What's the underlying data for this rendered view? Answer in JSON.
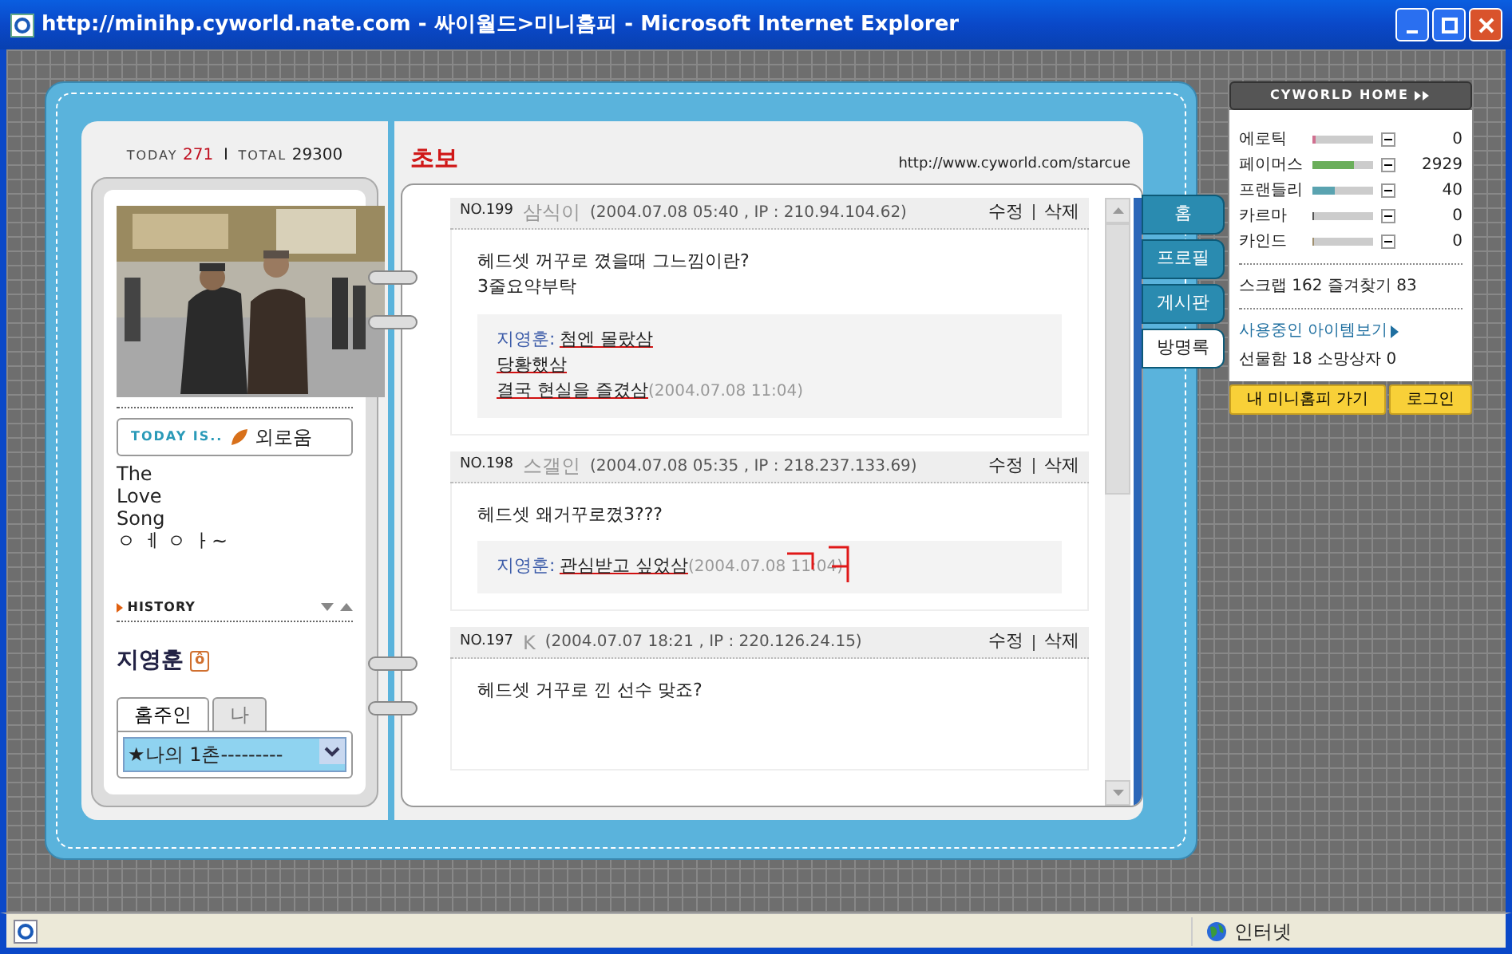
{
  "window": {
    "title": "http://minihp.cyworld.nate.com - 싸이월드>미니홈피 - Microsoft Internet Explorer"
  },
  "counter": {
    "today_label": "TODAY",
    "today": "271",
    "separator": "I",
    "total_label": "TOTAL",
    "total": "29300"
  },
  "profile": {
    "picture": {
      "kind": "picture"
    },
    "today_is": "TODAY IS..",
    "mood": "외로움",
    "intro": [
      "The",
      "Love",
      "Song",
      "ㅇ ㅔ ㅇ ㅏ~"
    ],
    "history": "HISTORY",
    "owner": "지영훈",
    "owner_badge": "ô",
    "tabs": [
      {
        "label": "홈주인",
        "selected": true
      },
      {
        "label": "나",
        "selected": false
      }
    ],
    "select": "★나의 1촌---------"
  },
  "page": {
    "title": "초보",
    "url": "http://www.cyworld.com/starcue"
  },
  "guestbook": [
    {
      "no_label": "NO.",
      "no": "199",
      "author": "삼식이",
      "meta": "(2004.07.08 05:40 , IP : 210.94.104.62)",
      "edit": "수정",
      "delete": "삭제",
      "body": [
        "헤드셋 꺼꾸로 꼈을때 그느낌이란?",
        "3줄요약부탁"
      ],
      "reply": {
        "author": "지영훈:",
        "lines": [
          "첨엔 몰랐삼",
          "당황했삼",
          "결국 현실을 즐겼삼"
        ],
        "time": "(2004.07.08 11:04)"
      },
      "scribble": false
    },
    {
      "no_label": "NO.",
      "no": "198",
      "author": "스갤인",
      "meta": "(2004.07.08 05:35 , IP : 218.237.133.69)",
      "edit": "수정",
      "delete": "삭제",
      "body": [
        "헤드셋 왜거꾸로꼈3???"
      ],
      "reply": {
        "author": "지영훈:",
        "lines": [
          "관심받고 싶었삼"
        ],
        "time": "(2004.07.08 11:04)"
      },
      "scribble": true
    },
    {
      "no_label": "NO.",
      "no": "197",
      "author": "K",
      "meta": "(2004.07.07 18:21 , IP : 220.126.24.15)",
      "edit": "수정",
      "delete": "삭제",
      "body": [
        "헤드셋 거꾸로 낀 선수 맞죠?"
      ]
    }
  ],
  "tabs": [
    {
      "label": "홈",
      "selected": false
    },
    {
      "label": "프로필",
      "selected": false
    },
    {
      "label": "게시판",
      "selected": false
    },
    {
      "label": "방명록",
      "selected": true
    }
  ],
  "side": {
    "home": "CYWORLD HOME",
    "stats": [
      {
        "name": "에로틱",
        "level": 0.04,
        "color": "#d07090",
        "value": "0"
      },
      {
        "name": "페이머스",
        "level": 0.68,
        "color": "#6aae5a",
        "value": "2929"
      },
      {
        "name": "프랜들리",
        "level": 0.38,
        "color": "#5aa3b0",
        "value": "40"
      },
      {
        "name": "카르마",
        "level": 0.02,
        "color": "#555555",
        "value": "0"
      },
      {
        "name": "카인드",
        "level": 0.02,
        "color": "#a09070",
        "value": "0"
      }
    ],
    "scrap": "스크랩 162 즐겨찾기 83",
    "items_link": "사용중인 아이템보기",
    "gift": "선물함 18 소망상자 0",
    "buttons": [
      "내 미니홈피 가기",
      "로그인"
    ]
  },
  "status_bar": {
    "zone": "인터넷"
  }
}
